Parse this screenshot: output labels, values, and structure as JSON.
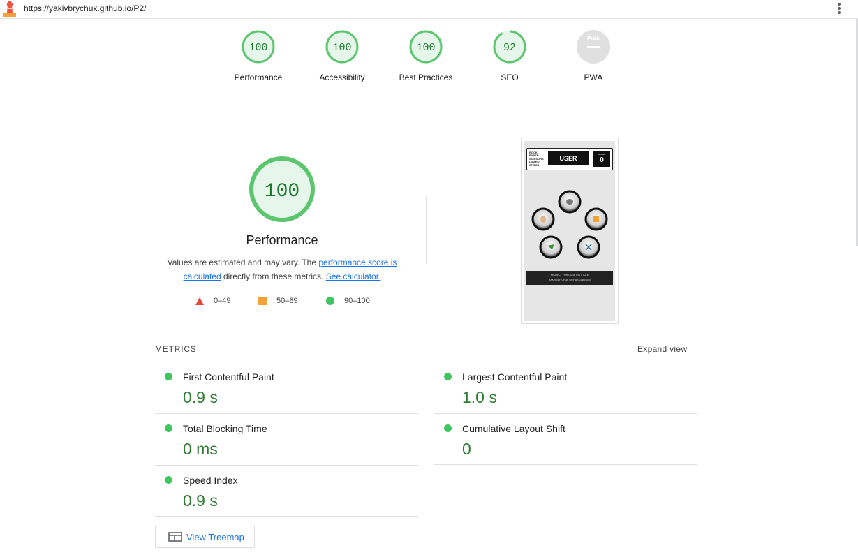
{
  "url": "https://yakivbrychuk.github.io/P2/",
  "colors": {
    "pass": "#0cce6b",
    "pass_text": "#008800",
    "average": "#ffa400",
    "fail": "#ff4e42",
    "link": "#1a73e8"
  },
  "category_scores": [
    {
      "label": "Performance",
      "score": "100",
      "value": 100
    },
    {
      "label": "Accessibility",
      "score": "100",
      "value": 100
    },
    {
      "label": "Best Practices",
      "score": "100",
      "value": 100
    },
    {
      "label": "SEO",
      "score": "92",
      "value": 92
    },
    {
      "label": "PWA",
      "score": "",
      "badge": "PWA"
    }
  ],
  "main": {
    "score": "100",
    "title": "Performance",
    "desc_prefix": "Values are estimated and may vary. The ",
    "desc_link1": "performance score is calculated",
    "desc_middle": " directly from these metrics. ",
    "desc_link2": "See calculator."
  },
  "legend": [
    {
      "range": "0–49",
      "icon": "triangle-icon"
    },
    {
      "range": "50–89",
      "icon": "square-icon"
    },
    {
      "range": "90–100",
      "icon": "circle-icon"
    }
  ],
  "screenshot": {
    "options": "ROCK PAPER SCISSORS LIZARD SPOCK",
    "user_label": "USER",
    "score_label": "SCORE",
    "score_value": "0",
    "footer_line1": "PROJECT FOR CODE INSTITUTE",
    "footer_line2": "YAKIV BRYCHUK GITHUB LINKEDIN"
  },
  "metrics": {
    "title": "METRICS",
    "expand_label": "Expand view",
    "items": [
      {
        "name": "First Contentful Paint",
        "value": "0.9 s"
      },
      {
        "name": "Largest Contentful Paint",
        "value": "1.0 s"
      },
      {
        "name": "Total Blocking Time",
        "value": "0 ms"
      },
      {
        "name": "Cumulative Layout Shift",
        "value": "0"
      },
      {
        "name": "Speed Index",
        "value": "0.9 s"
      }
    ]
  },
  "treemap_label": "View Treemap"
}
